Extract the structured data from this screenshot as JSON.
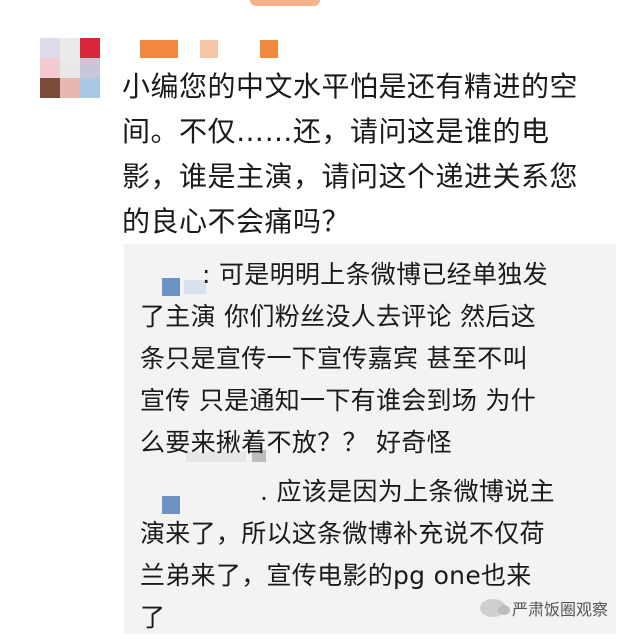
{
  "main_comment": {
    "lines": [
      "小编您的中文水平怕是还有精进的空",
      "间。不仅……还，请问这是谁的电",
      "影，谁是主演，请问这个递进关系您",
      "的良心不会痛吗？"
    ]
  },
  "replies": [
    {
      "lines": [
        ": 可是明明上条微博已经单独发",
        "了主演 你们粉丝没人去评论 然后这",
        "条只是宣传一下宣传嘉宾 甚至不叫",
        "宣传 只是通知一下有谁会到场 为什",
        "么要来揪着不放？？ 好奇怪"
      ]
    },
    {
      "lines": [
        ". 应该是因为上条微博说主",
        "演来了，所以这条微博补充说不仅荷",
        "兰弟来了，宣传电影的pg one也来",
        "了"
      ]
    }
  ],
  "watermark": {
    "text": "严肃饭圈观察",
    "icon": "wechat-icon"
  },
  "avatar_colors": [
    "#dcdcea",
    "#eaeaea",
    "#d9273a",
    "#f2ccd2",
    "#e9e9e9",
    "#c7c7d9",
    "#7b4b3a",
    "#e7b7b0",
    "#a7c9e6"
  ]
}
